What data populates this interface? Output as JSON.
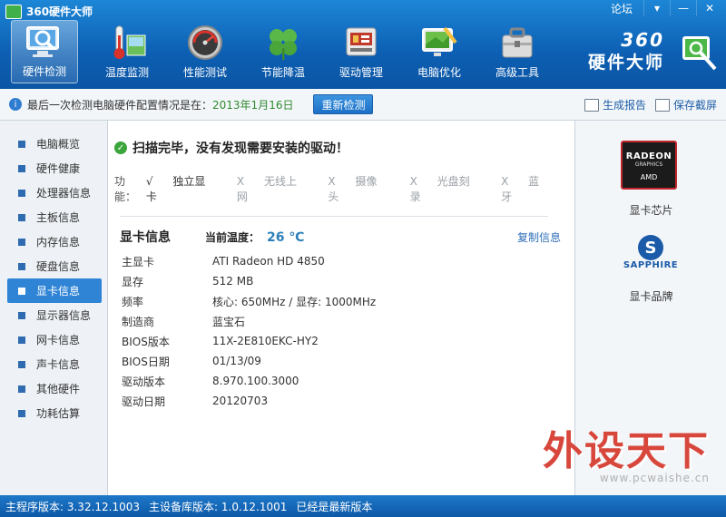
{
  "window": {
    "title": "360硬件大师",
    "forum_label": "论坛",
    "controls": [
      "▾",
      "—",
      "✕"
    ]
  },
  "nav": {
    "items": [
      {
        "label": "硬件检测",
        "icon": "monitor-magnifier-icon",
        "active": true
      },
      {
        "label": "温度监测",
        "icon": "thermometer-icon",
        "active": false
      },
      {
        "label": "性能测试",
        "icon": "speedometer-icon",
        "active": false
      },
      {
        "label": "节能降温",
        "icon": "clover-icon",
        "active": false
      },
      {
        "label": "驱动管理",
        "icon": "driver-board-icon",
        "active": false
      },
      {
        "label": "电脑优化",
        "icon": "monitor-brush-icon",
        "active": false
      },
      {
        "label": "高级工具",
        "icon": "toolbox-icon",
        "active": false
      }
    ]
  },
  "brand": {
    "number": "360",
    "name": "硬件大师"
  },
  "infobar": {
    "text": "最后一次检测电脑硬件配置情况是在：",
    "date": "2013年1月16日",
    "redetect_label": "重新检测",
    "report_label": "生成报告",
    "screenshot_label": "保存截屏"
  },
  "sidebar": {
    "items": [
      {
        "label": "电脑概览",
        "active": false
      },
      {
        "label": "硬件健康",
        "active": false
      },
      {
        "label": "处理器信息",
        "active": false
      },
      {
        "label": "主板信息",
        "active": false
      },
      {
        "label": "内存信息",
        "active": false
      },
      {
        "label": "硬盘信息",
        "active": false
      },
      {
        "label": "显卡信息",
        "active": true
      },
      {
        "label": "显示器信息",
        "active": false
      },
      {
        "label": "网卡信息",
        "active": false
      },
      {
        "label": "声卡信息",
        "active": false
      },
      {
        "label": "其他硬件",
        "active": false
      },
      {
        "label": "功耗估算",
        "active": false
      }
    ]
  },
  "scan": {
    "message": "扫描完毕，没有发现需要安装的驱动！",
    "features_label": "功能：",
    "features": [
      {
        "mark": "√",
        "label": "独立显卡",
        "ok": true
      },
      {
        "mark": "X",
        "label": "无线上网",
        "ok": false
      },
      {
        "mark": "X",
        "label": "摄像头",
        "ok": false
      },
      {
        "mark": "X",
        "label": "光盘刻录",
        "ok": false
      },
      {
        "mark": "X",
        "label": "蓝牙",
        "ok": false
      }
    ]
  },
  "gpu": {
    "title": "显卡信息",
    "temp_label": "当前温度：",
    "temp_value": "26 ℃",
    "copy_label": "复制信息",
    "specs": [
      {
        "key": "主显卡",
        "value": "ATI Radeon HD 4850"
      },
      {
        "key": "显存",
        "value": "512 MB"
      },
      {
        "key": "频率",
        "value": "核心: 650MHz / 显存: 1000MHz"
      },
      {
        "key": "制造商",
        "value": "蓝宝石"
      },
      {
        "key": "BIOS版本",
        "value": "11X-2E810EKC-HY2"
      },
      {
        "key": "BIOS日期",
        "value": "01/13/09"
      },
      {
        "key": "驱动版本",
        "value": "8.970.100.3000"
      },
      {
        "key": "驱动日期",
        "value": "20120703"
      }
    ]
  },
  "right": {
    "chip_logo": {
      "line1": "RADEON",
      "line2": "GRAPHICS",
      "line3": "AMD"
    },
    "chip_label": "显卡芯片",
    "brand_logo": {
      "mark": "S",
      "text": "SAPPHIRE"
    },
    "brand_label": "显卡品牌"
  },
  "status": {
    "main_version": "主程序版本: 3.32.12.1003",
    "db_version": "主设备库版本: 1.0.12.1001",
    "latest": "已经是最新版本"
  },
  "watermark": {
    "text": "外设天下",
    "url": "www.pcwaishe.cn"
  },
  "colors": {
    "accent": "#2f84d5",
    "title_bar": "#0d5fb3",
    "ok_green": "#3ba63b",
    "temp": "#2d7fb8",
    "watermark": "#d8473c"
  }
}
